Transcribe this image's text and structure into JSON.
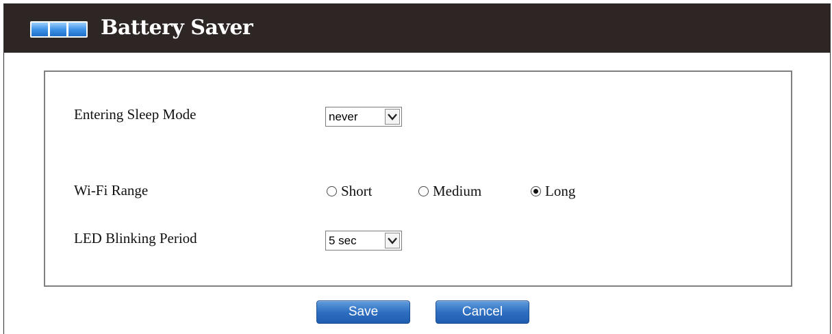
{
  "header": {
    "title": "Battery Saver",
    "icon": "battery-icon",
    "background": "#2d2624"
  },
  "form": {
    "sleep_mode": {
      "label": "Entering Sleep Mode",
      "value": "never"
    },
    "wifi_range": {
      "label": "Wi-Fi Range",
      "options": [
        "Short",
        "Medium",
        "Long"
      ],
      "selected": "Long"
    },
    "led_period": {
      "label": "LED Blinking Period",
      "value": "5 sec"
    }
  },
  "buttons": {
    "save": "Save",
    "cancel": "Cancel",
    "color": "#2e6fc2"
  }
}
